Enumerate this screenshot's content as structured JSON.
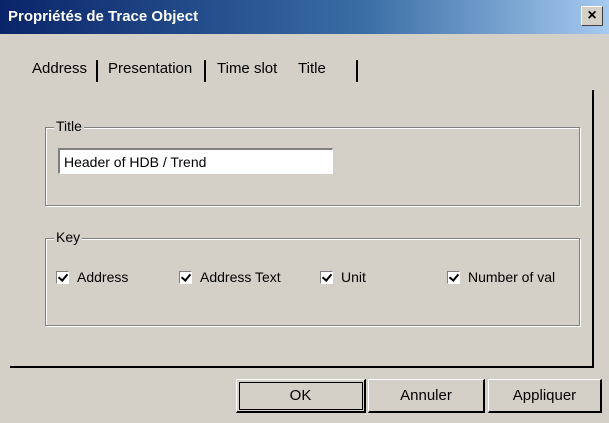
{
  "window": {
    "title": "Propriétés de Trace Object",
    "close_glyph": "×"
  },
  "tabs": [
    {
      "label": "Address"
    },
    {
      "label": "Presentation"
    },
    {
      "label": "Time slot"
    },
    {
      "label": "Title",
      "selected": true
    }
  ],
  "title_group": {
    "label": "Title",
    "value": "Header of HDB / Trend"
  },
  "key_group": {
    "label": "Key",
    "options": [
      {
        "label": "Address",
        "checked": true
      },
      {
        "label": "Address Text",
        "checked": true
      },
      {
        "label": "Unit",
        "checked": true
      },
      {
        "label": "Number of val",
        "checked": true
      }
    ]
  },
  "buttons": {
    "ok": "OK",
    "cancel": "Annuler",
    "apply": "Appliquer"
  }
}
